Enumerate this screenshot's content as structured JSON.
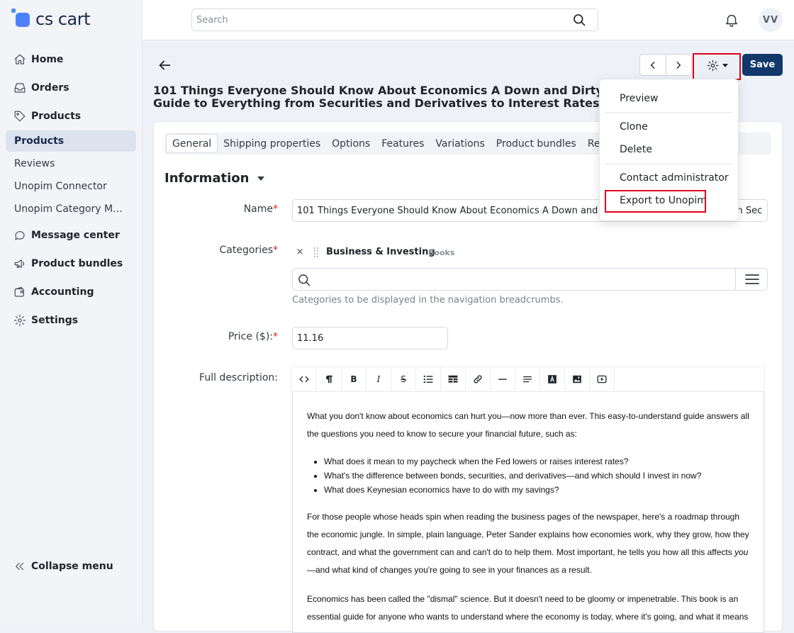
{
  "brand": {
    "name": "cs cart",
    "accent": "#3a86ff"
  },
  "sidebar": {
    "items": [
      {
        "label": "Home",
        "icon": "home-icon"
      },
      {
        "label": "Orders",
        "icon": "inbox-icon"
      },
      {
        "label": "Products",
        "icon": "tag-icon"
      }
    ],
    "sub_items": [
      {
        "label": "Products",
        "active": true
      },
      {
        "label": "Reviews"
      },
      {
        "label": "Unopim Connector"
      },
      {
        "label": "Unopim Category Mapping"
      }
    ],
    "more_items": [
      {
        "label": "Message center",
        "icon": "chat-icon"
      },
      {
        "label": "Product bundles",
        "icon": "megaphone-icon"
      },
      {
        "label": "Accounting",
        "icon": "wallet-icon"
      },
      {
        "label": "Settings",
        "icon": "gear-icon"
      }
    ],
    "collapse_label": "Collapse menu"
  },
  "topbar": {
    "search_placeholder": "Search",
    "avatar_initials": "VV"
  },
  "header": {
    "save_label": "Save",
    "title": "101 Things Everyone Should Know About Economics A Down and Dirty Guide to Everything from Securities and Derivatives to Interest Rates and Hedge Funds—And What They Mean For You"
  },
  "tabs": [
    "General",
    "Shipping properties",
    "Options",
    "Features",
    "Variations",
    "Product bundles",
    "Reviews"
  ],
  "info": {
    "section_title": "Information",
    "name_label": "Name",
    "name_value": "101 Things Everyone Should Know About Economics A Down and Dirty Guide to Everything from Securities",
    "categories_label": "Categories",
    "category_name": "Business & Investing",
    "category_parent": "Books",
    "categories_help": "Categories to be displayed in the navigation breadcrumbs.",
    "price_label": "Price ($):",
    "price_value": "11.16",
    "description_label": "Full description:",
    "required_mark": "*"
  },
  "editor": {
    "toolbar": [
      "code",
      "paragraph",
      "bold",
      "italic",
      "strikethrough",
      "bulleted-list",
      "table",
      "link",
      "horizontal-rule",
      "align",
      "text-color",
      "image",
      "video"
    ],
    "p1": "What you don't know about economics can hurt you—now more than ever. This easy-to-understand guide answers all the questions you need to know to secure your financial future, such as:",
    "bullets": [
      "What does it mean to my paycheck when the Fed lowers or raises interest rates?",
      "What's the difference between bonds, securities, and derivatives—and which should I invest in now?",
      "What does Keynesian economics have to do with my savings?"
    ],
    "p2a": "For those people whose heads spin when reading the business pages of the newspaper, here's a roadmap through the economic jungle. In simple, plain language, Peter Sander explains how economies work, why they grow, how they contract, and what the government can and can't do to help them. Most important, he tells you how all this affects ",
    "p2_em": "you",
    "p2b": "—and what kind of changes you're going to see in your finances as a result.",
    "p3": "Economics has been called the \"dismal\" science. But it doesn't need to be gloomy or impenetrable. This book is an essential guide for anyone who wants to understand where the economy is today, where it's going, and what it means"
  },
  "dropdown": {
    "preview": "Preview",
    "clone": "Clone",
    "delete": "Delete",
    "contact": "Contact administrator",
    "export": "Export to Unopim"
  }
}
